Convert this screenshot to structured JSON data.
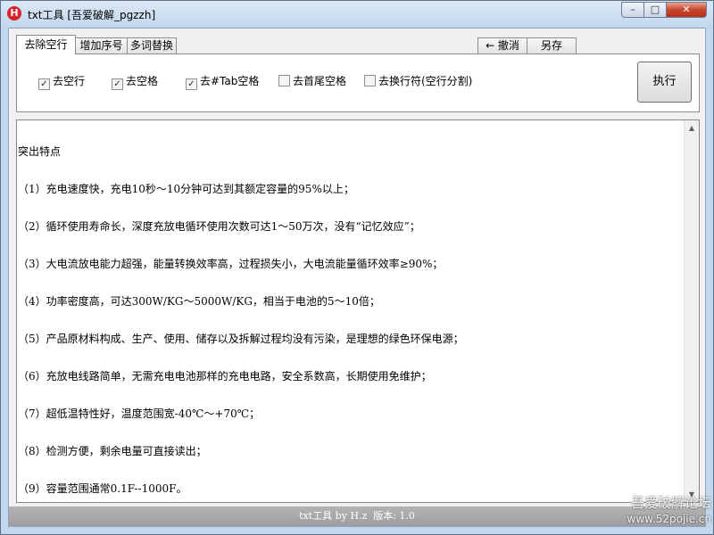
{
  "window": {
    "title": "txt工具 [吾爱破解_pgzzh]",
    "icon_letter": "H",
    "controls": {
      "minimize": "–",
      "maximize": "□",
      "close": "✕"
    }
  },
  "tabs": [
    {
      "label": "去除空行",
      "active": true
    },
    {
      "label": "增加序号",
      "active": false
    },
    {
      "label": "多词替换",
      "active": false
    }
  ],
  "toolbar": {
    "undo_label": "← 撤消",
    "saveas_label": "另存"
  },
  "options": [
    {
      "label": "去空行",
      "checked": true
    },
    {
      "label": "去空格",
      "checked": true
    },
    {
      "label": "去#Tab空格",
      "checked": true
    },
    {
      "label": "去首尾空格",
      "checked": false
    },
    {
      "label": "去换行符(空行分割)",
      "checked": false
    }
  ],
  "run_button": "执行",
  "editor": {
    "lines": [
      "突出特点",
      "（1）充电速度快，充电10秒～10分钟可达到其额定容量的95%以上；",
      "（2）循环使用寿命长，深度充放电循环使用次数可达1～50万次，没有“记忆效应”；",
      "（3）大电流放电能力超强，能量转换效率高，过程损失小，大电流能量循环效率≥90%；",
      "（4）功率密度高，可达300W/KG～5000W/KG，相当于电池的5～10倍；",
      "（5）产品原材料构成、生产、使用、储存以及拆解过程均没有污染，是理想的绿色环保电源；",
      "（6）充放电线路简单，无需充电电池那样的充电电路，安全系数高，长期使用免维护；",
      "（7）超低温特性好，温度范围宽-40℃～+70℃；",
      "（8）检测方便，剩余电量可直接读出；",
      "（9）容量范围通常0.1F--1000F。"
    ]
  },
  "statusbar": {
    "text": "txt工具 by H.z  版本: 1.0"
  },
  "watermark": {
    "line1": "吾爱破解论坛",
    "line2": "www.52pojie.cn"
  }
}
